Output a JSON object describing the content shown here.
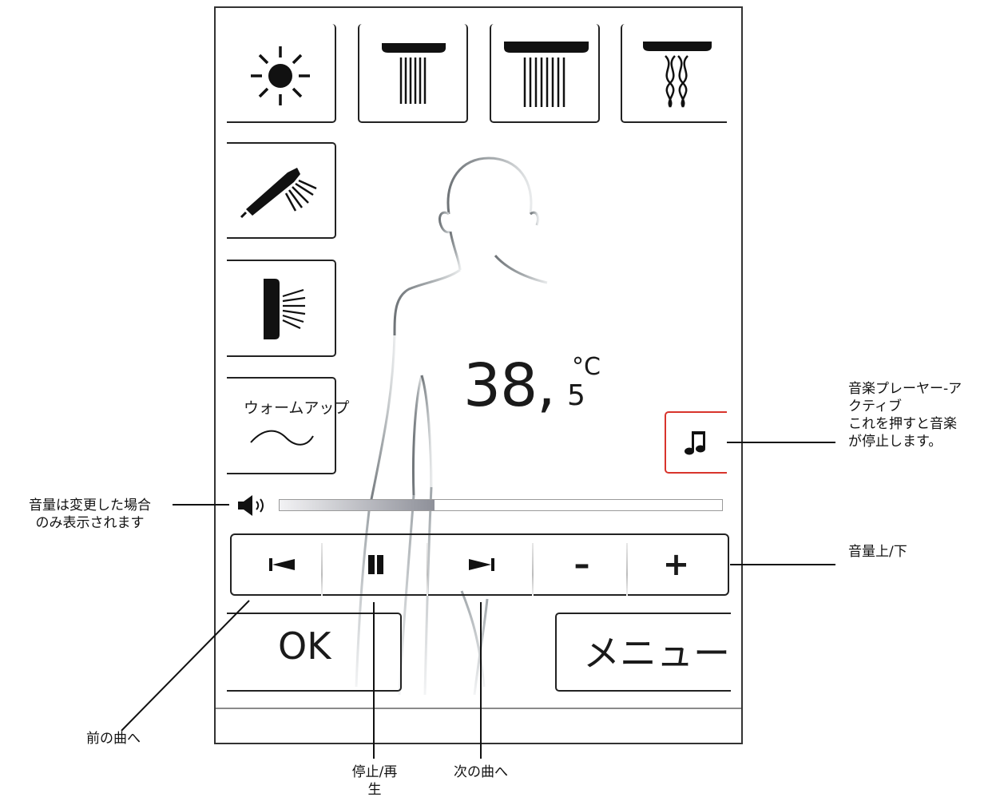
{
  "display": {
    "temperature_value": "38,",
    "temperature_decimal": "5",
    "temperature_unit": "°C",
    "warmup_label": "ウォームアップ",
    "ok_label": "OK",
    "menu_label": "メニュー",
    "volume_level": 0.35
  },
  "controls": {
    "minus_label": "–",
    "plus_label": "+"
  },
  "icons": {
    "top_row": [
      "sun-icon",
      "rain-shower-narrow-icon",
      "rain-shower-wide-icon",
      "massage-shower-icon"
    ],
    "left_column": [
      "hand-shower-icon",
      "side-jet-icon",
      "warmup-wave-icon"
    ],
    "player": [
      "previous-track-icon",
      "pause-icon",
      "next-track-icon",
      "minus-icon",
      "plus-icon"
    ],
    "music": "music-note-icon",
    "volume": "speaker-icon"
  },
  "colors": {
    "music_active_border": "#d8342c"
  },
  "callouts": {
    "music_player": [
      "音楽プレーヤー-ア",
      "クティブ",
      "これを押すと音楽",
      "が停止します。"
    ],
    "volume_info": [
      "音量は変更した場合",
      "のみ表示されます"
    ],
    "volume_up_down": "音量上/下",
    "previous_track": "前の曲へ",
    "stop_play": [
      "停止/再",
      "生"
    ],
    "next_track": "次の曲へ"
  }
}
